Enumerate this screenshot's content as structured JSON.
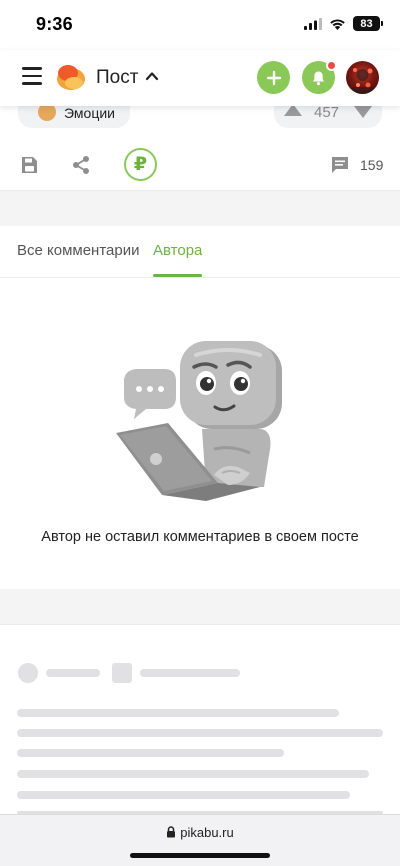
{
  "status_bar": {
    "time": "9:36",
    "battery": "83"
  },
  "header": {
    "title": "Пост"
  },
  "post": {
    "emotions_label": "Эмоции",
    "rating": "457",
    "donate_symbol": "₽",
    "comments_count": "159"
  },
  "tabs": [
    {
      "label": "Все комментарии",
      "active": false
    },
    {
      "label": "Автора",
      "active": true
    }
  ],
  "empty_state": {
    "message": "Автор не оставил комментариев в своем посте"
  },
  "browser": {
    "url": "pikabu.ru"
  },
  "colors": {
    "accent_green": "#8ac858",
    "tab_active": "#6cb341",
    "notification_dot": "#ea4c43",
    "skeleton": "#e1e1e3"
  },
  "icons": [
    "hamburger-icon",
    "pikabu-logo",
    "chevron-up-icon",
    "plus-icon",
    "bell-icon",
    "save-icon",
    "share-icon",
    "ruble-icon",
    "comment-icon",
    "lock-icon"
  ]
}
